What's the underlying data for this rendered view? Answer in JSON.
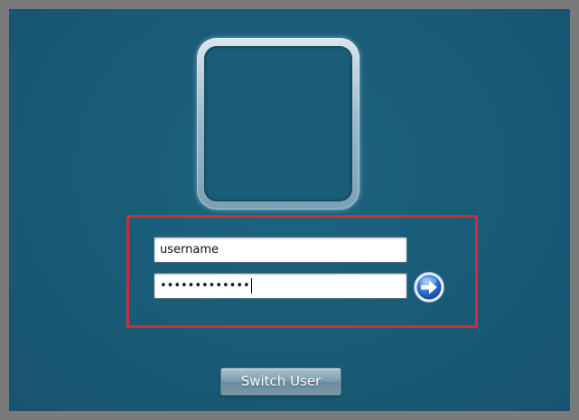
{
  "login": {
    "username_value": "username",
    "password_mask": "•••••••••••••"
  },
  "switch_user": {
    "label": "Switch User"
  },
  "icons": {
    "submit": "arrow-right-circle-icon"
  },
  "colors": {
    "background": "#1a5d78",
    "highlight": "#d9283a",
    "submit_blue": "#2f6fd1"
  }
}
